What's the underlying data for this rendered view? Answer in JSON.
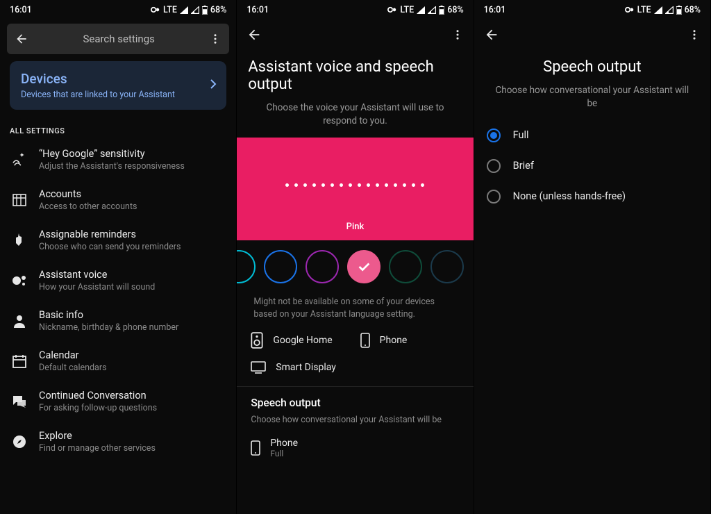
{
  "status": {
    "time": "16:01",
    "network": "LTE",
    "battery": "68%"
  },
  "pane1": {
    "search_placeholder": "Search settings",
    "devices": {
      "title": "Devices",
      "subtitle": "Devices that are linked to your Assistant"
    },
    "section_label": "ALL SETTINGS",
    "items": [
      {
        "title": "“Hey Google” sensitivity",
        "subtitle": "Adjust the Assistant's responsiveness"
      },
      {
        "title": "Accounts",
        "subtitle": "Access to other accounts"
      },
      {
        "title": "Assignable reminders",
        "subtitle": "Choose who can send you reminders"
      },
      {
        "title": "Assistant voice",
        "subtitle": "How your Assistant will sound"
      },
      {
        "title": "Basic info",
        "subtitle": "Nickname, birthday & phone number"
      },
      {
        "title": "Calendar",
        "subtitle": "Default calendars"
      },
      {
        "title": "Continued Conversation",
        "subtitle": "For asking follow-up questions"
      },
      {
        "title": "Explore",
        "subtitle": "Find or manage other services"
      }
    ]
  },
  "pane2": {
    "title": "Assistant voice and speech output",
    "subtitle": "Choose the voice your Assistant will use to respond to you.",
    "voice_name": "Pink",
    "note": "Might not be available on some of your devices based on your Assistant language setting.",
    "devices": [
      "Google Home",
      "Phone",
      "Smart Display"
    ],
    "speech": {
      "title": "Speech output",
      "subtitle": "Choose how conversational your Assistant will be",
      "item_title": "Phone",
      "item_value": "Full"
    },
    "colors": [
      "#00bcd4",
      "#1a73e8",
      "#9c27b0",
      "#ec5a8d",
      "#0f4c3a",
      "#1b3a4b"
    ]
  },
  "pane3": {
    "title": "Speech output",
    "subtitle": "Choose how conversational your Assistant will be",
    "options": [
      "Full",
      "Brief",
      "None (unless hands-free)"
    ],
    "selected": "Full"
  }
}
